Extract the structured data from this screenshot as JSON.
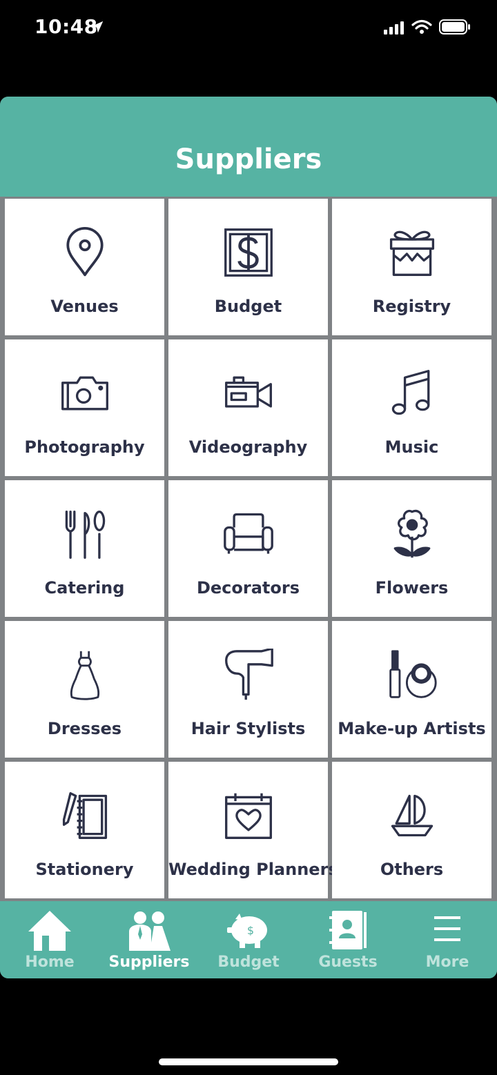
{
  "status_bar": {
    "time": "10:48",
    "icons": [
      "location-arrow-icon",
      "signal-icon",
      "wifi-icon",
      "battery-icon"
    ]
  },
  "header": {
    "title": "Suppliers"
  },
  "categories": [
    {
      "label": "Venues",
      "icon": "map-pin-icon"
    },
    {
      "label": "Budget",
      "icon": "dollar-frame-icon"
    },
    {
      "label": "Registry",
      "icon": "gift-box-icon"
    },
    {
      "label": "Photography",
      "icon": "camera-icon"
    },
    {
      "label": "Videography",
      "icon": "video-camera-icon"
    },
    {
      "label": "Music",
      "icon": "music-note-icon"
    },
    {
      "label": "Catering",
      "icon": "cutlery-icon"
    },
    {
      "label": "Decorators",
      "icon": "armchair-icon"
    },
    {
      "label": "Flowers",
      "icon": "flower-icon"
    },
    {
      "label": "Dresses",
      "icon": "dress-icon"
    },
    {
      "label": "Hair Stylists",
      "icon": "hair-dryer-icon"
    },
    {
      "label": "Make-up Artists",
      "icon": "makeup-icon"
    },
    {
      "label": "Stationery",
      "icon": "notebook-pencil-icon"
    },
    {
      "label": "Wedding Planners",
      "icon": "calendar-heart-icon"
    },
    {
      "label": "Others",
      "icon": "sailboat-icon"
    }
  ],
  "tabbar": {
    "active": "Suppliers",
    "tabs": [
      {
        "label": "Home",
        "icon": "house-icon"
      },
      {
        "label": "Suppliers",
        "icon": "couple-icon"
      },
      {
        "label": "Budget",
        "icon": "piggy-bank-icon"
      },
      {
        "label": "Guests",
        "icon": "contacts-book-icon"
      },
      {
        "label": "More",
        "icon": "hamburger-menu-icon"
      }
    ]
  },
  "colors": {
    "header_bg": "#56b3a3",
    "grid_divider": "#7f8285",
    "tile_bg": "#ffffff",
    "icon_label": "#2d3148",
    "tab_inactive": "#bfe3dc",
    "tab_active": "#ffffff"
  }
}
